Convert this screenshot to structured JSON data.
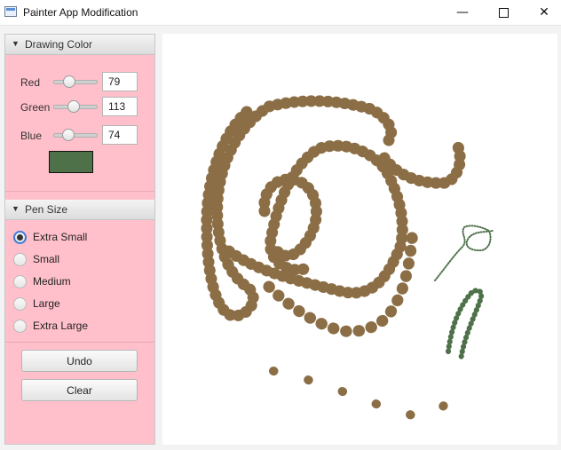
{
  "window": {
    "title": "Painter App Modification",
    "minimize_icon": "minimize-icon",
    "maximize_icon": "maximize-icon",
    "close_icon": "close-icon",
    "minimize_glyph": "—",
    "close_glyph": "✕"
  },
  "drawing_color": {
    "header": "Drawing Color",
    "arrow_glyph": "▼",
    "red_label": "Red",
    "green_label": "Green",
    "blue_label": "Blue",
    "red": "79",
    "green": "113",
    "blue": "74",
    "swatch_color": "#4f714a"
  },
  "pen_size": {
    "header": "Pen Size",
    "arrow_glyph": "▼",
    "options": [
      "Extra Small",
      "Small",
      "Medium",
      "Large",
      "Extra Large"
    ],
    "selected": "Extra Small"
  },
  "buttons": {
    "undo": "Undo",
    "clear": "Clear"
  },
  "colors": {
    "sidebar_bg": "#ffc0cb",
    "brown_stroke": "#8b6e45",
    "green_stroke": "#4f714a",
    "canvas_bg": "#ffffff"
  }
}
